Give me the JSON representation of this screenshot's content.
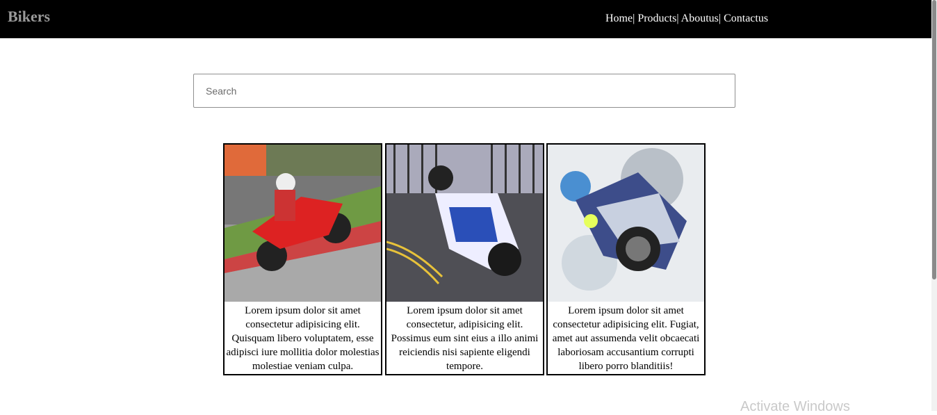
{
  "header": {
    "brand": "Bikers",
    "nav": {
      "home": "Home",
      "products": "Products",
      "aboutus": "Aboutus",
      "contactus": "Contactus",
      "separator": "|"
    }
  },
  "search": {
    "placeholder": "Search",
    "value": ""
  },
  "cards": [
    {
      "caption": "Lorem ipsum dolor sit amet consectetur adipisicing elit. Quisquam libero voluptatem, esse adipisci iure mollitia dolor molestias molestiae veniam culpa."
    },
    {
      "caption": "Lorem ipsum dolor sit amet consectetur, adipisicing elit. Possimus eum sint eius a illo animi reiciendis nisi sapiente eligendi tempore."
    },
    {
      "caption": "Lorem ipsum dolor sit amet consectetur adipisicing elit. Fugiat, amet aut assumenda velit obcaecati laboriosam accusantium corrupti libero porro blanditiis!"
    }
  ],
  "watermark": "Activate Windows",
  "colors": {
    "topbar": "#000000",
    "brand": "#9a9a9a",
    "nav": "#ffffff"
  }
}
